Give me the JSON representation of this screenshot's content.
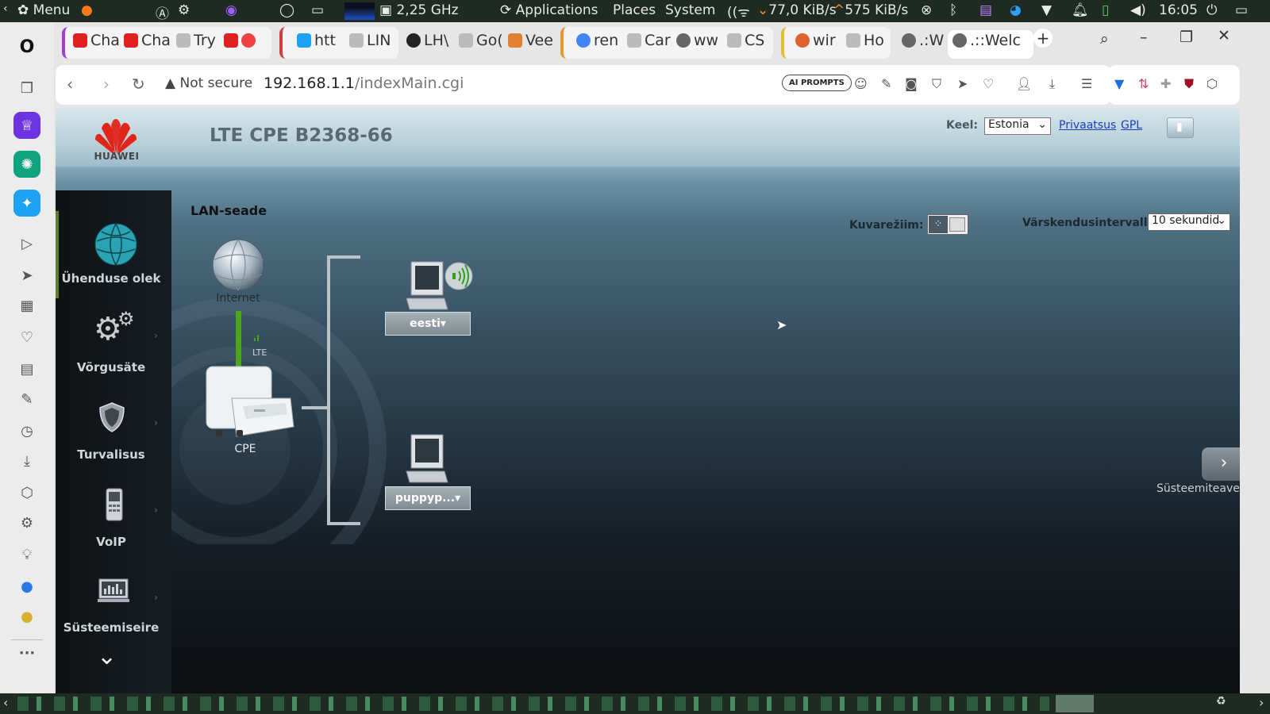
{
  "system_bar": {
    "menu_label": "Menu",
    "cpu_freq": "2,25 GHz",
    "applications": "Applications",
    "places": "Places",
    "system": "System",
    "net_down": "77,0 KiB/s",
    "net_up": "575 KiB/s",
    "clock": "16:05"
  },
  "tabs": [
    {
      "label": "Cha",
      "color": "#e02020"
    },
    {
      "label": "Cha",
      "color": "#e02020"
    },
    {
      "label": "Try",
      "color": "#888888"
    },
    {
      "label": "htt",
      "color": "#1da1f2"
    },
    {
      "label": "LIN",
      "color": "#888888"
    },
    {
      "label": "LH\\",
      "color": "#222222"
    },
    {
      "label": "Go(",
      "color": "#888888"
    },
    {
      "label": "Vee",
      "color": "#e08030"
    },
    {
      "label": "ren",
      "color": "#4285f4"
    },
    {
      "label": "Car",
      "color": "#888888"
    },
    {
      "label": "ww",
      "color": "#666666"
    },
    {
      "label": "CS",
      "color": "#888888"
    },
    {
      "label": "wir",
      "color": "#e06030"
    },
    {
      "label": "Ho",
      "color": "#888888"
    },
    {
      "label": ".:W",
      "color": "#666666"
    },
    {
      "label": ".::Welc",
      "color": "#666666"
    }
  ],
  "address": {
    "security": "Not secure",
    "host": "192.168.1.1",
    "path": "/indexMain.cgi",
    "ai_prompts": "AI PROMPTS"
  },
  "router": {
    "logo_text": "HUAWEI",
    "model": "LTE CPE B2368-66",
    "language_label": "Keel:",
    "language_value": "Estonia",
    "privacy_link": "Privaatsus",
    "gpl_link": "GPL",
    "section_title": "LAN-seade",
    "display_mode_label": "Kuvarežiim:",
    "refresh_label": "Värskendusintervall:",
    "refresh_value": "10 sekundid",
    "internet_label": "Internet",
    "lte_label": "LTE",
    "cpe_label": "CPE",
    "devices": [
      {
        "name": "eesti▾",
        "wireless": true
      },
      {
        "name": "puppyp...▾",
        "wireless": false
      }
    ],
    "system_info_label": "Süsteemiteave"
  },
  "nav": [
    {
      "label": "Ühenduse olek",
      "icon": "globe-icon"
    },
    {
      "label": "Võrgusäte",
      "icon": "gears-icon"
    },
    {
      "label": "Turvalisus",
      "icon": "shield-icon"
    },
    {
      "label": "VoIP",
      "icon": "phone-icon"
    },
    {
      "label": "Süsteemiseire",
      "icon": "monitor-icon"
    }
  ]
}
